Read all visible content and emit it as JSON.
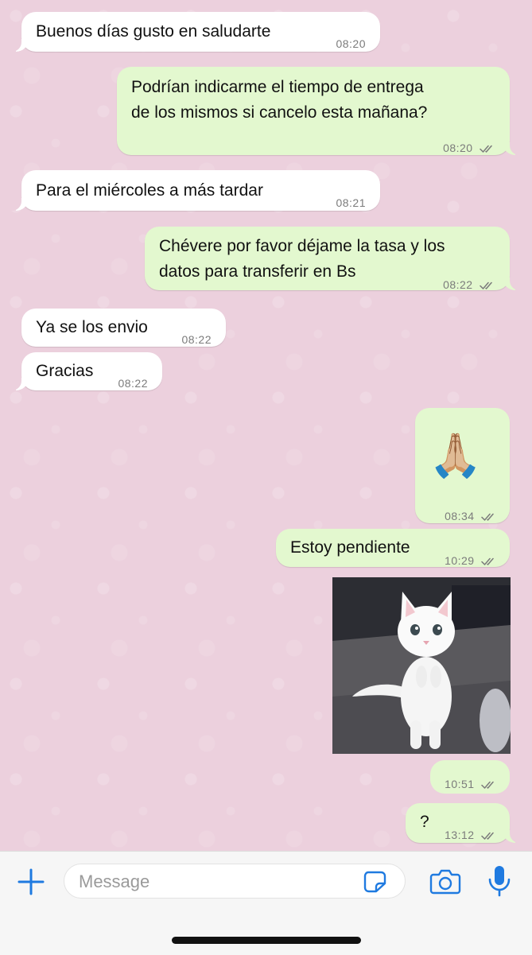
{
  "messages": [
    {
      "id": "m1",
      "direction": "in",
      "text": "Buenos días gusto en saludarte",
      "time": "08:20"
    },
    {
      "id": "m2",
      "direction": "out",
      "text": "Podrían indicarme el tiempo de entrega\nde los mismos si cancelo esta mañana?",
      "time": "08:20",
      "status": "read"
    },
    {
      "id": "m3",
      "direction": "in",
      "text": "Para el miércoles a más tardar",
      "time": "08:21"
    },
    {
      "id": "m4",
      "direction": "out",
      "text": "Chévere por favor déjame la tasa y los\ndatos para transferir en Bs",
      "time": "08:22",
      "status": "read"
    },
    {
      "id": "m5",
      "direction": "in",
      "text": "Ya se los envio",
      "time": "08:22"
    },
    {
      "id": "m6",
      "direction": "in",
      "text": "Gracias",
      "time": "08:22"
    },
    {
      "id": "m7",
      "direction": "out",
      "text": "🙏🏼",
      "time": "08:34",
      "status": "read"
    },
    {
      "id": "m8",
      "direction": "out",
      "text": "Estoy pendiente",
      "time": "10:29",
      "status": "read"
    },
    {
      "id": "m9",
      "direction": "out",
      "type": "image",
      "image": "white-kitten-standing",
      "time": "10:51",
      "status": "read"
    },
    {
      "id": "m10",
      "direction": "out",
      "text": "?",
      "time": "13:12",
      "status": "read"
    }
  ],
  "composer": {
    "placeholder": "Message"
  },
  "icons": {
    "attach": "plus-icon",
    "sticker": "sticker-icon",
    "camera": "camera-icon",
    "mic": "microphone-icon",
    "read": "double-check-icon"
  },
  "colors": {
    "accent": "#1f7ae0",
    "outgoing_bubble": "#e3f8cf",
    "incoming_bubble": "#ffffff",
    "chat_background": "#ecd0dd"
  }
}
